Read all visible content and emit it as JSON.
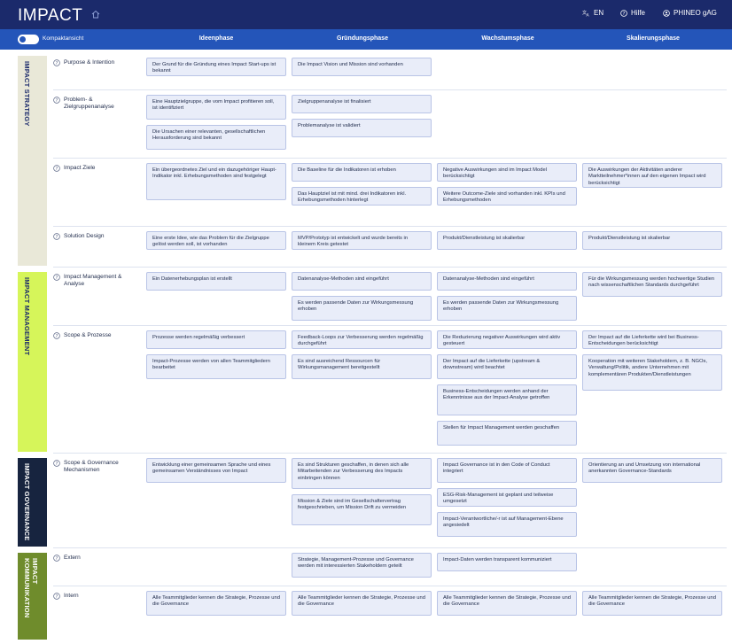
{
  "header": {
    "logo": "IMPACT",
    "language": "EN",
    "help": "Hilfe",
    "account": "PHINEO gAG"
  },
  "toolbar": {
    "compact_view_label": "Kompaktansicht",
    "compact_view_on": true
  },
  "phases": [
    "Ideenphase",
    "Gründungsphase",
    "Wachstumsphase",
    "Skalierungsphase"
  ],
  "categories": [
    {
      "label": "IMPACT STRATEGY",
      "color": "#e9e8d8",
      "text_color": "#1b2a6b"
    },
    {
      "label": "IMPACT MANAGEMENT",
      "color": "#d6f55a",
      "text_color": "#1b2a6b"
    },
    {
      "label": "IMPACT GOVERNANCE",
      "color": "#17243f",
      "text_color": "#ffffff"
    },
    {
      "label": "IMPACT KOMMUNIKATION",
      "color": "#6f8c2c",
      "text_color": "#ffffff"
    }
  ],
  "rows": [
    {
      "title": "Purpose & Intention",
      "cells": [
        [
          "Der Grund für die Gründung eines Impact Start-ups ist bekannt"
        ],
        [
          "Die Impact Vision und Mission sind vorhanden"
        ],
        [],
        []
      ]
    },
    {
      "title": "Problem- & Zielgruppenanalyse",
      "cells": [
        [
          "Eine Hauptzielgruppe, die vom Impact profitieren soll, ist identifiziert",
          "Die Ursachen einer relevanten, gesellschaftlichen Herausforderung sind bekannt"
        ],
        [
          "Zielgruppenanalyse ist finalisiert",
          "Problemanalyse ist validiert"
        ],
        [],
        []
      ]
    },
    {
      "title": "Impact Ziele",
      "cells": [
        [
          "Ein übergeordnetes Ziel und ein dazugehöriger Haupt-Indikator inkl. Erhebungsmethoden sind festgelegt"
        ],
        [
          "Die Baseline für die Indikatoren ist erhoben",
          "Das Hauptziel ist mit mind. drei Indikatoren inkl. Erhebungsmethoden hinterlegt"
        ],
        [
          "Negative Auswirkungen sind im Impact Model berücksichtigt",
          "Weitere Outcome-Ziele sind vorhanden inkl. KPIs und Erhebungsmethoden"
        ],
        [
          "Die Auswirkungen der Aktivitäten anderer Marktteilnehmer*innen auf den eigenen Impact wird berücksichtigt"
        ]
      ]
    },
    {
      "title": "Solution Design",
      "cells": [
        [
          "Eine erste Idee, wie das Problem für die Zielgruppe gelöst werden soll, ist vorhanden"
        ],
        [
          "MVP/Prototyp ist entwickelt und wurde bereits in kleinem Kreis getestet"
        ],
        [
          "Produkt/Dienstleistung ist skalierbar"
        ],
        [
          "Produkt/Dienstleistung ist skalierbar"
        ]
      ]
    },
    {
      "title": "Impact Management & Analyse",
      "cells": [
        [
          "Ein Datenerhebungsplan ist erstellt"
        ],
        [
          "Datenanalyse-Methoden sind eingeführt",
          "Es werden passende Daten zur Wirkungsmessung erhoben"
        ],
        [
          "Datenanalyse-Methoden sind eingeführt",
          "Es werden passende Daten zur Wirkungsmessung erhoben"
        ],
        [
          "Für die Wirkungsmessung werden hochwertige Studien nach wissenschaftlichen Standards durchgeführt"
        ]
      ]
    },
    {
      "title": "Scope & Prozesse",
      "cells": [
        [
          "Prozesse werden regelmäßig verbessert",
          "Impact-Prozesse werden von allen Teammitgliedern bearbeitet"
        ],
        [
          "Feedback-Loops zur Verbesserung werden regelmäßig durchgeführt",
          "Es sind ausreichend Ressourcen für Wirkungsmanagement bereitgestellt"
        ],
        [
          "Die Reduzierung negativer Auswirkungen wird aktiv gesteuert",
          "Der Impact auf die Lieferkette (upstream & downstream) wird beachtet",
          "Business-Entscheidungen werden anhand der Erkenntnisse aus der Impact-Analyse getroffen",
          "Stellen für Impact Management werden geschaffen"
        ],
        [
          "Der Impact auf die Lieferkette wird bei Business-Entscheidungen berücksichtigt",
          "Kooperation mit weiteren Stakeholdern, z. B. NGOs, Verwaltung/Politik, andere Unternehmen mit komplementären Produkten/Dienstleistungen"
        ]
      ]
    },
    {
      "title": "Scope & Governance Mechanismen",
      "cells": [
        [
          "Entwicklung einer gemeinsamen Sprache und eines gemeinsamen Verständnisses von Impact"
        ],
        [
          "Es sind Strukturen geschaffen, in denen sich alle Mitarbeitenden zur Verbesserung des Impacts einbringen können",
          "Mission & Ziele sind im Gesellschaftervertrag festgeschrieben, um Mission Drift zu vermeiden"
        ],
        [
          "Impact Governance ist in den Code of Conduct integriert",
          "ESG-Risk-Management ist geplant und teilweise umgesetzt",
          "Impact-Verantwortliche/-r ist auf Management-Ebene angesiedelt"
        ],
        [
          "Orientierung an und Umsetzung von international anerkannten Governance-Standards"
        ]
      ]
    },
    {
      "title": "Extern",
      "cells": [
        [],
        [
          "Strategie, Management-Prozesse und Governance werden mit interessierten Stakeholdern geteilt"
        ],
        [
          "Impact-Daten werden transparent kommuniziert"
        ],
        []
      ]
    },
    {
      "title": "Intern",
      "cells": [
        [
          "Alle Teammitglieder kennen die Strategie, Prozesse und die Governance"
        ],
        [
          "Alle Teammitglieder kennen die Strategie, Prozesse und die Governance"
        ],
        [
          "Alle Teammitglieder kennen die Strategie, Prozesse und die Governance"
        ],
        [
          "Alle Teammitglieder kennen die Strategie, Prozesse und die Governance"
        ]
      ]
    }
  ]
}
